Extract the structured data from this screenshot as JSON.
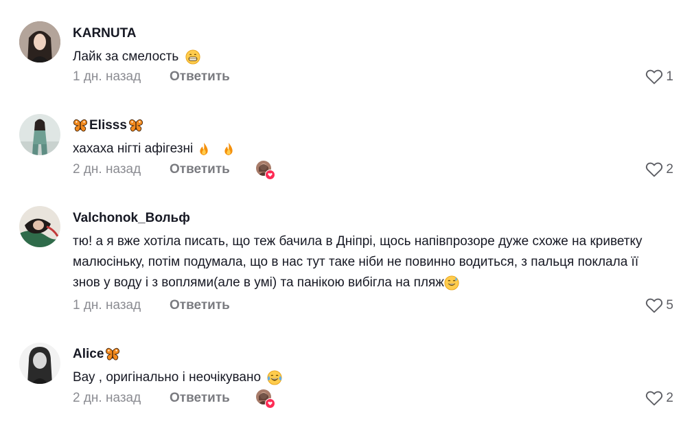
{
  "reply_label": "Ответить",
  "comments": [
    {
      "username": "KARNUTA",
      "text": "Лайк за смелость",
      "emoji": "grinning-face",
      "time": "1 дн. назад",
      "likes": "1",
      "liked_by_creator": false
    },
    {
      "username": "Elisss",
      "username_decor": "butterfly",
      "text": "хахаха нігті афігезні",
      "emoji": "fire",
      "time": "2 дн. назад",
      "likes": "2",
      "liked_by_creator": true
    },
    {
      "username": "Valchonok_Вольф",
      "text": "тю! а я вже хотіла писать, що теж бачила в Дніпрі, щось напівпрозоре дуже схоже на криветку малюсіньку, потім подумала, що в нас тут таке ніби не повинно водиться, з пальця поклала її знов у воду і з воплями(але в умі) та панікою вибігла на пляж",
      "emoji": "grinning-face-with-sweat",
      "time": "1 дн. назад",
      "likes": "5",
      "liked_by_creator": false
    },
    {
      "username": "Alice",
      "username_decor": "butterfly",
      "text": "Вау , оригінально і неочікувано",
      "emoji": "face-with-tears-of-joy",
      "time": "2 дн. назад",
      "likes": "2",
      "liked_by_creator": true
    }
  ],
  "colors": {
    "text": "#161823",
    "meta": "#8a8b91",
    "reply": "#7a7b80",
    "like_count": "#5c5d63",
    "accent_heart": "#fe2c55"
  },
  "icons": {
    "like": "heart-outline-icon",
    "liked_by_creator_badge": "heart-icon",
    "username_decor": "butterfly-icon"
  }
}
